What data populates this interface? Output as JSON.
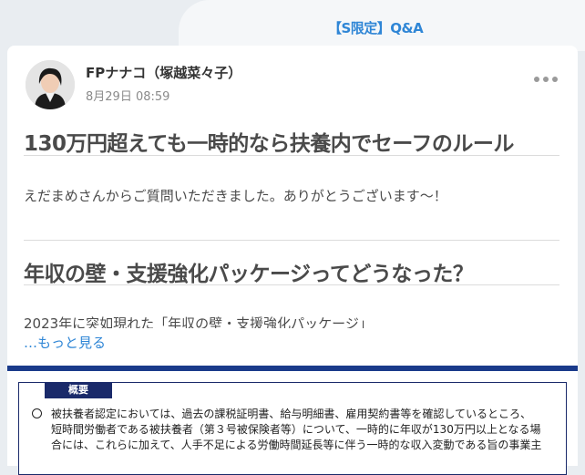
{
  "tab": {
    "label": "【S限定】Q&A"
  },
  "post": {
    "author": "FPナナコ（塚越菜々子）",
    "date": "8月29日 08:59",
    "headline1": "130万円超えても一時的なら扶養内でセーフのルール",
    "intro": "えだまめさんからご質問いただきました。ありがとうございます～！",
    "headline2": "年収の壁・支援強化パッケージってどうなった？",
    "clipped_text": "2023年に突如現れた「年収の壁・支援強化パッケージ」",
    "more_link": "…もっと見る"
  },
  "document": {
    "badge": "概要",
    "lines": [
      "被扶養者認定においては、過去の課税証明書、給与明細書、雇用契約書等を確認しているところ、",
      "短時間労働者である被扶養者（第３号被保険者等）について、一時的に年収が130万円以上となる場",
      "合には、これらに加えて、人手不足による労働時間延長等に伴う一時的な収入変動である旨の事業主"
    ]
  },
  "colors": {
    "accent": "#2f86d6",
    "navy": "#1a2a6a"
  }
}
